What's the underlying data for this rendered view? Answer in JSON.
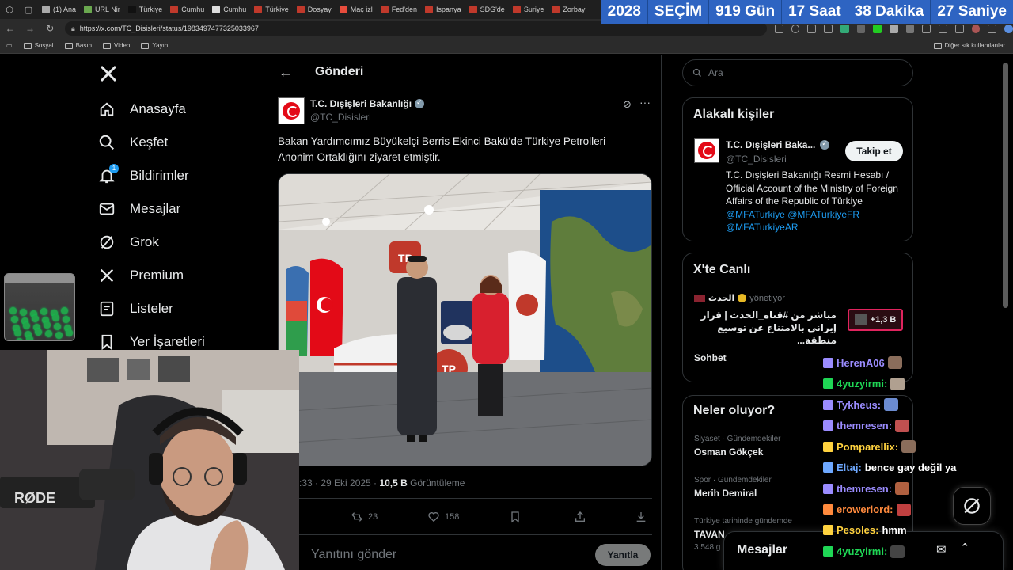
{
  "browser": {
    "tabs": [
      {
        "label": "(1) Ana",
        "color": "#aaa"
      },
      {
        "label": "URL Nir",
        "color": "#6aa84f"
      },
      {
        "label": "Türkiye",
        "color": "#111"
      },
      {
        "label": "Cumhu",
        "color": "#c0392b"
      },
      {
        "label": "Cumhu",
        "color": "#ddd"
      },
      {
        "label": "Türkiye",
        "color": "#c0392b"
      },
      {
        "label": "Dosyay",
        "color": "#c0392b"
      },
      {
        "label": "Maç izl",
        "color": "#e74c3c"
      },
      {
        "label": "Fed'den",
        "color": "#c0392b"
      },
      {
        "label": "İspanya",
        "color": "#c0392b"
      },
      {
        "label": "SDG'de",
        "color": "#c0392b"
      },
      {
        "label": "Suriye",
        "color": "#c0392b"
      },
      {
        "label": "Zorbay",
        "color": "#c0392b"
      }
    ],
    "url": "https://x.com/TC_Disisleri/status/1983497477325033967",
    "bookmarks": [
      "Sosyal",
      "Basın",
      "Video",
      "Yayın"
    ],
    "other_bookmarks": "Diğer sık kullanılanlar"
  },
  "countdown": {
    "year": "2028",
    "label": "SEÇİM",
    "days": "919 Gün",
    "hours": "17 Saat",
    "minutes": "38 Dakika",
    "seconds": "27 Saniye"
  },
  "nav": {
    "items": [
      {
        "label": "Anasayfa",
        "icon": "home-icon"
      },
      {
        "label": "Keşfet",
        "icon": "search-icon"
      },
      {
        "label": "Bildirimler",
        "icon": "bell-icon"
      },
      {
        "label": "Mesajlar",
        "icon": "mail-icon"
      },
      {
        "label": "Grok",
        "icon": "grok-icon"
      },
      {
        "label": "Premium",
        "icon": "x-icon"
      },
      {
        "label": "Listeler",
        "icon": "list-icon"
      },
      {
        "label": "Yer İşaretleri",
        "icon": "bookmark-icon"
      }
    ],
    "notif_count": "1"
  },
  "post": {
    "header_title": "Gönderi",
    "author_name": "T.C. Dışişleri Bakanlığı",
    "author_handle": "@TC_Disisleri",
    "text": "Bakan Yardımcımız Büyükelçi Berris Ekinci Bakü’de Türkiye Petrolleri Anonim Ortaklığını ziyaret etmiştir.",
    "time": ":33 · 29 Eki 2025 · ",
    "views": "10,5 B",
    "views_label": " Görüntüleme",
    "reposts": "23",
    "likes": "158",
    "reply_placeholder": "Yanıtını gönder",
    "reply_button": "Yanıtla"
  },
  "sidebar": {
    "search_placeholder": "Ara",
    "related": {
      "title": "Alakalı kişiler",
      "name": "T.C. Dışişleri Baka...",
      "handle": "@TC_Disisleri",
      "follow": "Takip et",
      "bio": "T.C. Dışişleri Bakanlığı Resmi Hesabı / Official Account of the Ministry of Foreign Affairs of the Republic of Türkiye ",
      "bio_links": "@MFATurkiye @MFATurkiyeFR @MFATurkiyeAR"
    },
    "live": {
      "title": "X'te Canlı",
      "host": "الحدث",
      "host_status": "yönetiyor",
      "stream_title": "مباشر من #قناة_الحدث | قرار إيراني بالامتناع عن توسيع منطقة...",
      "listeners": "+1,3 B",
      "sohbet": "Sohbet"
    },
    "trends": {
      "title": "Neler oluyor?",
      "items": [
        {
          "category": "Siyaset · Gündemdekiler",
          "name": "Osman Gökçek"
        },
        {
          "category": "Spor · Gündemdekiler",
          "name": "Merih Demiral"
        },
        {
          "category": "Türkiye tarihinde gündemde",
          "name": "TAVAN",
          "count": "3.548 g"
        }
      ]
    },
    "messages": "Mesajlar"
  },
  "chat": [
    {
      "user": "HerenA06",
      "msg": "",
      "color": "#9b8cff"
    },
    {
      "user": "4yuzyirmi:",
      "msg": "",
      "color": "#1fd655"
    },
    {
      "user": "Tykheus:",
      "msg": "",
      "color": "#9b8cff"
    },
    {
      "user": "themresen:",
      "msg": "",
      "color": "#9b8cff"
    },
    {
      "user": "Pomparellix:",
      "msg": "",
      "color": "#ffd23f"
    },
    {
      "user": "Eltaj:",
      "msg": "bence gay değil ya",
      "color": "#6ea8ff"
    },
    {
      "user": "themresen:",
      "msg": "",
      "color": "#9b8cff"
    },
    {
      "user": "erowerlord:",
      "msg": "",
      "color": "#ff8a3d"
    },
    {
      "user": "Pesoles:",
      "msg": "hmm",
      "color": "#ffd23f"
    },
    {
      "user": "4yuzyirmi:",
      "msg": "",
      "color": "#1fd655"
    }
  ]
}
